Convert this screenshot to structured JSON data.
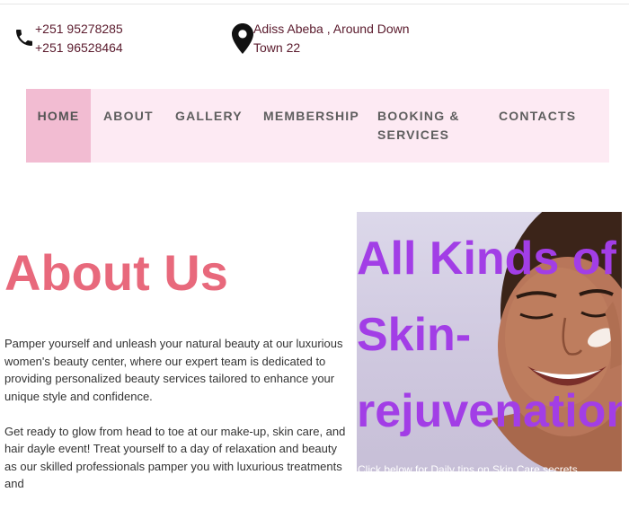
{
  "contact": {
    "phone_1": "+251 95278285",
    "phone_2": "+251 96528464",
    "address_line_1": "Adiss Abeba , Around Down",
    "address_line_2": "Town 22",
    "phone_icon": "phone-icon",
    "location_icon": "location-pin-icon"
  },
  "nav": {
    "items": [
      {
        "label": "HOME",
        "active": true
      },
      {
        "label": "ABOUT",
        "active": false
      },
      {
        "label": "GALLERY",
        "active": false
      },
      {
        "label": "MEMBERSHIP",
        "active": false
      },
      {
        "label": "BOOKING &",
        "label_line_2": "SERVICES",
        "active": false
      },
      {
        "label": "CONTACTS",
        "active": false
      }
    ]
  },
  "about": {
    "title": "About Us",
    "paragraph_1": "Pamper yourself and unleash your natural beauty at our luxurious women's beauty center, where our expert team is dedicated to providing personalized beauty services tailored to enhance your unique style and confidence.",
    "paragraph_2": "Get ready to glow from head to toe at our make-up, skin care, and hair dayle event! Treat yourself to a day of relaxation and beauty as our skilled professionals pamper you with luxurious treatments and"
  },
  "hero": {
    "heading": "All Kinds of Skin-rejuvenation",
    "caption": "Click below for Daily tips on Skin Care secrets"
  },
  "colors": {
    "accent": "#e8697c",
    "nav_background": "#fdeaf3",
    "nav_active": "#f2bcd2",
    "hero_heading": "#a23ee6",
    "contact_text": "#5a1a2c"
  }
}
